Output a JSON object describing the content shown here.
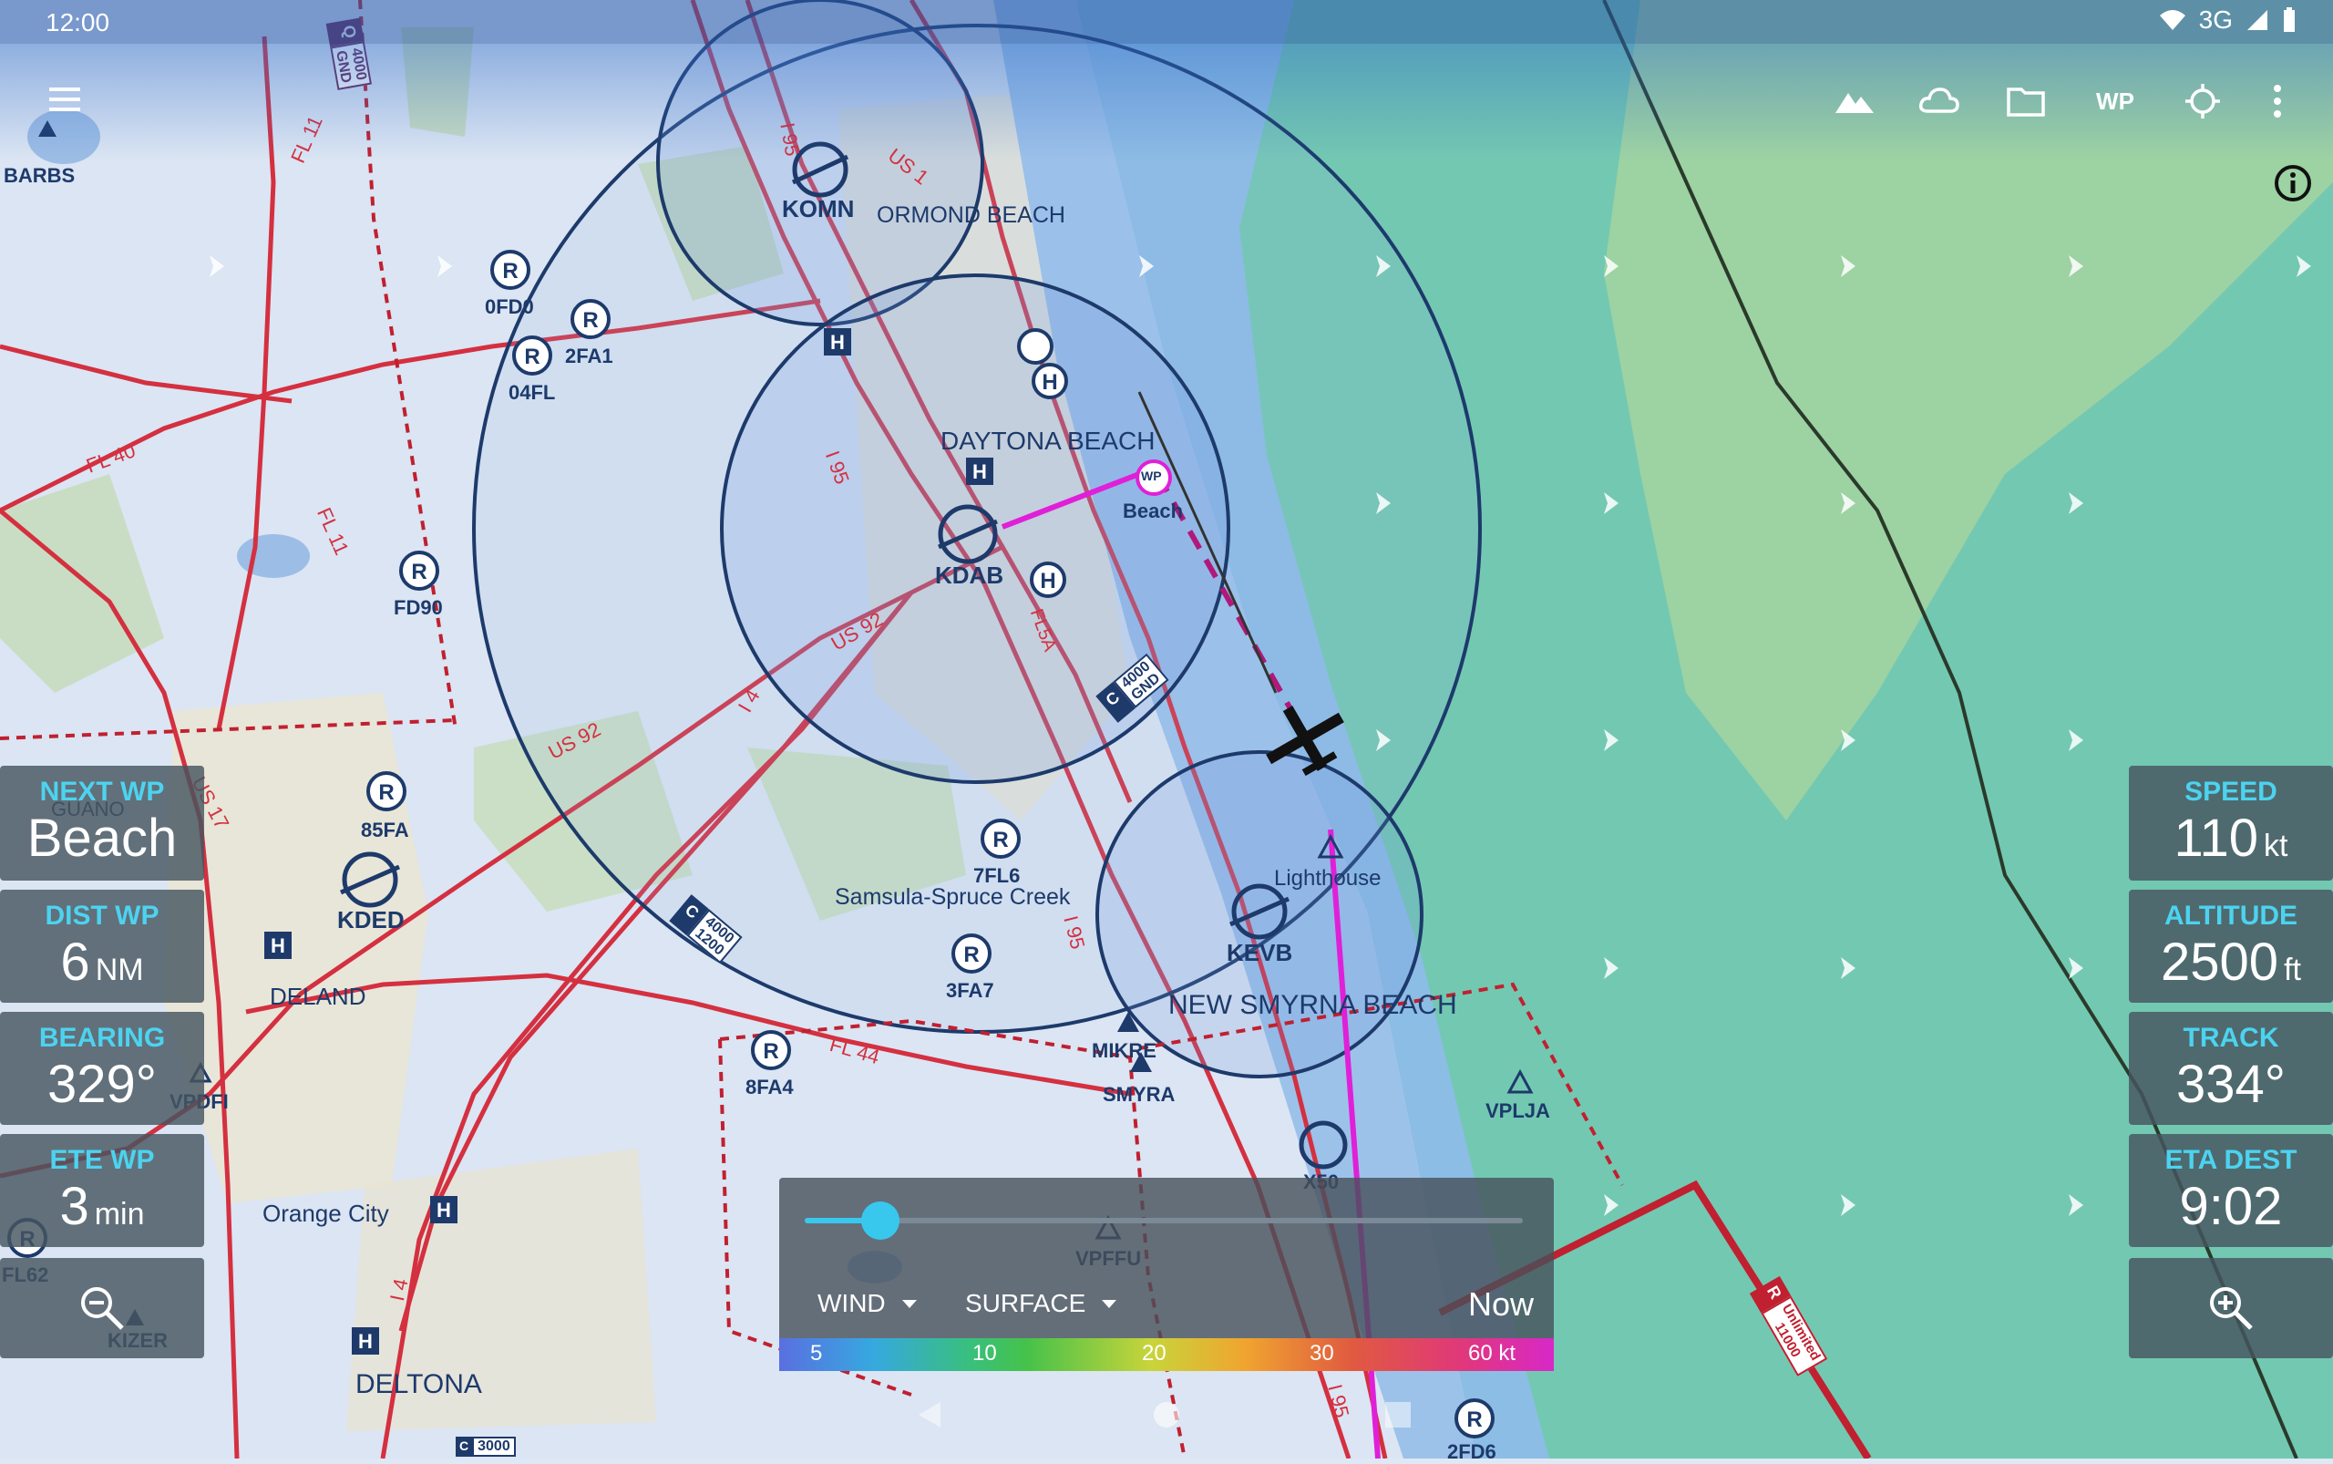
{
  "status_bar": {
    "time": "12:00",
    "network": "3G"
  },
  "toolbar": {
    "menu_icon": "hamburger-icon",
    "terrain_icon": "mountain-icon",
    "weather_icon": "cloud-icon",
    "files_icon": "folder-icon",
    "wp_label": "WP",
    "location_icon": "crosshair-icon",
    "overflow_icon": "more-vert-icon"
  },
  "map": {
    "places": {
      "daytona_beach": "DAYTONA BEACH",
      "ormond_beach": "ORMOND BEACH",
      "new_smyrna_beach": "NEW SMYRNA BEACH",
      "deland": "DELAND",
      "deltona": "DELTONA",
      "orange_city": "Orange City",
      "samsula": "Samsula-Spruce Creek",
      "guano": "GUANO"
    },
    "airports": {
      "komn": "KOMN",
      "kdab": "KDAB",
      "kevb": "KEVB",
      "kded": "KDED",
      "x50": "X50",
      "ofd0": "0FD0",
      "fa2": "2FA1",
      "fl04": "04FL",
      "fd90": "FD90",
      "fa85": "85FA",
      "fl7": "7FL6",
      "fa3": "3FA7",
      "fa8": "8FA4",
      "fl62": "FL62",
      "fd6": "2FD6"
    },
    "fixes": {
      "barbs": "BARBS",
      "mikre": "MIKRE",
      "smyra": "SMYRA",
      "vplja": "VPLJA",
      "vpdfi": "VPDFI",
      "vpffu": "VPFFU",
      "kizer": "KIZER",
      "lighthouse": "Lighthouse",
      "beach": "Beach",
      "wp": "WP"
    },
    "roads": {
      "us1": "US 1",
      "us92_a": "US 92",
      "us92_b": "US 92",
      "us17": "US 17",
      "i95_a": "I 95",
      "i95_b": "I 95",
      "i95_c": "I 95",
      "i4_a": "I 4",
      "i4_b": "I 4",
      "fl11_a": "FL 11",
      "fl11_b": "FL 11",
      "fl40": "FL 40",
      "fl44": "FL 44",
      "fl5a": "FL5A",
      "i95_d": "I 95"
    },
    "airspace": {
      "c1_top": "4000",
      "c1_bot": "GND",
      "c2_top": "4000",
      "c2_bot": "1200",
      "q_top": "4000",
      "q_bot": "GND",
      "bottom_top": "3000",
      "r_top": "Unlimited",
      "r_bot": "11000",
      "cls_c": "C",
      "cls_r": "R",
      "cls_q": "Q"
    }
  },
  "left_instruments": {
    "next_wp": {
      "label": "NEXT WP",
      "value": "Beach"
    },
    "dist_wp": {
      "label": "DIST WP",
      "value": "6",
      "unit": "NM"
    },
    "bearing": {
      "label": "BEARING",
      "value": "329°"
    },
    "ete_wp": {
      "label": "ETE WP",
      "value": "3",
      "unit": "min"
    },
    "zoom_out_icon": "zoom-out-icon"
  },
  "right_instruments": {
    "speed": {
      "label": "SPEED",
      "value": "110",
      "unit": "kt"
    },
    "altitude": {
      "label": "ALTITUDE",
      "value": "2500",
      "unit": "ft"
    },
    "track": {
      "label": "TRACK",
      "value": "334°"
    },
    "eta_dest": {
      "label": "ETA DEST",
      "value": "9:02"
    },
    "zoom_in_icon": "zoom-in-icon"
  },
  "weather_overlay": {
    "layer": "WIND",
    "level": "SURFACE",
    "time": "Now",
    "slider_fraction": 0.105,
    "scale": [
      "5",
      "10",
      "20",
      "30",
      "60 kt"
    ]
  },
  "colors": {
    "accent": "#38c8ee",
    "route": "#e020d8",
    "roads": "#d43040",
    "airspace": "#1d3a6b"
  }
}
